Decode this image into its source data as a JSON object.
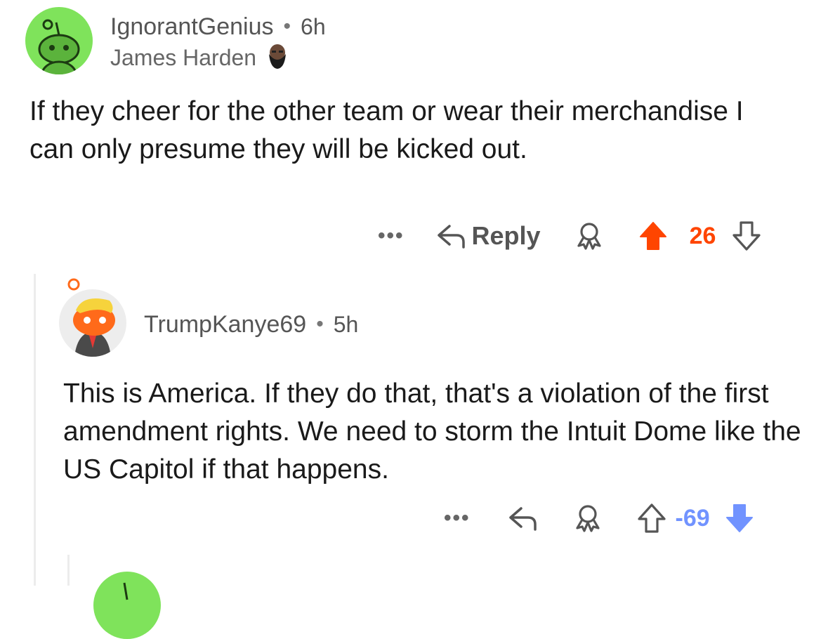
{
  "comments": [
    {
      "username": "IgnorantGenius",
      "separator": "•",
      "age": "6h",
      "flair": "James Harden",
      "body": "If they cheer for the other team or wear their merchandise I can only presume they will be kicked out.",
      "actions": {
        "more": "•••",
        "reply": "Reply",
        "score": "26",
        "vote_state": "upvoted"
      }
    },
    {
      "username": "TrumpKanye69",
      "separator": "•",
      "age": "5h",
      "body": "This is America. If they do that, that's a violation of the first amendment rights. We need to storm the Intuit Dome like the US Capitol if that happens.",
      "actions": {
        "more": "•••",
        "score": "-69",
        "vote_state": "downvoted"
      }
    }
  ],
  "colors": {
    "upvote": "#ff4500",
    "downvote": "#7193ff",
    "avatar_green": "#7fe35b",
    "avatar_grey": "#ededed",
    "avatar_orange": "#ff6a1a"
  },
  "icons": [
    "snoo-avatar-icon",
    "harden-flair-icon",
    "reply-arrow-icon",
    "award-icon",
    "upvote-arrow-icon",
    "downvote-arrow-icon",
    "more-options-icon"
  ]
}
